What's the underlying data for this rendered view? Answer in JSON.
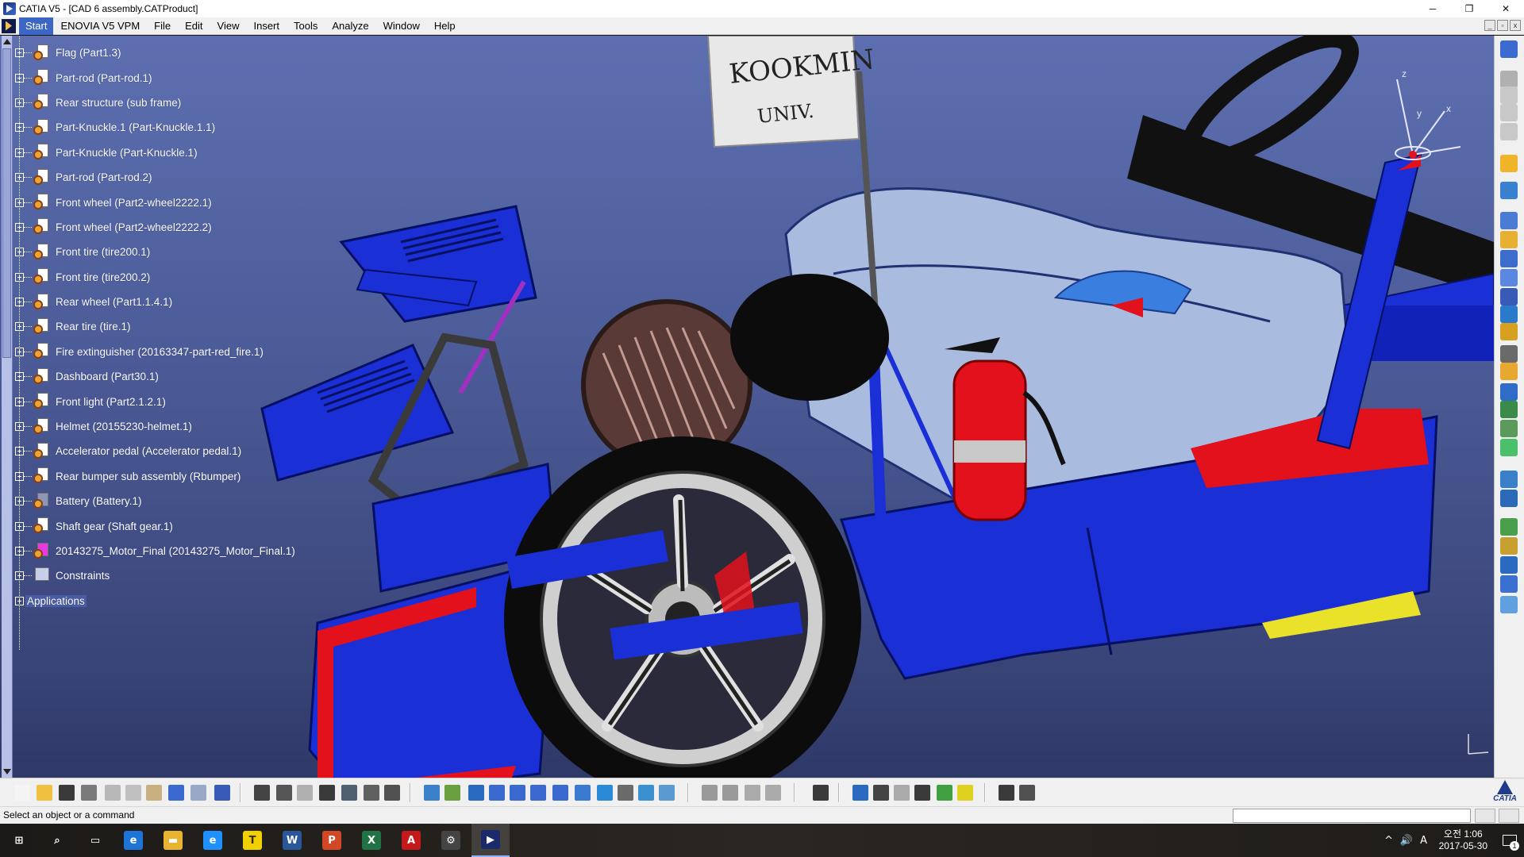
{
  "window": {
    "title": "CATIA V5 - [CAD 6 assembly.CATProduct]",
    "controls": [
      "─",
      "❐",
      "✕"
    ]
  },
  "menu": {
    "items": [
      "Start",
      "ENOVIA V5 VPM",
      "File",
      "Edit",
      "View",
      "Insert",
      "Tools",
      "Analyze",
      "Window",
      "Help"
    ],
    "mdi_controls": [
      "_",
      "▫",
      "x"
    ]
  },
  "tree": {
    "items": [
      {
        "label": "Flag (Part1.3)",
        "icon": "part-gear-icon"
      },
      {
        "label": "Part-rod (Part-rod.1)",
        "icon": "part-gear-icon"
      },
      {
        "label": "Rear structure (sub frame)",
        "icon": "part-gear-icon"
      },
      {
        "label": "Part-Knuckle.1 (Part-Knuckle.1.1)",
        "icon": "part-gear-icon"
      },
      {
        "label": "Part-Knuckle (Part-Knuckle.1)",
        "icon": "part-gear-icon"
      },
      {
        "label": "Part-rod (Part-rod.2)",
        "icon": "part-gear-icon"
      },
      {
        "label": "Front wheel  (Part2-wheel2222.1)",
        "icon": "part-gear-icon"
      },
      {
        "label": "Front wheel  (Part2-wheel2222.2)",
        "icon": "part-gear-icon"
      },
      {
        "label": "Front tire (tire200.1)",
        "icon": "part-gear-icon"
      },
      {
        "label": "Front tire (tire200.2)",
        "icon": "part-gear-icon"
      },
      {
        "label": "Rear wheel (Part1.1.4.1)",
        "icon": "part-gear-icon"
      },
      {
        "label": "Rear tire  (tire.1)",
        "icon": "part-gear-icon"
      },
      {
        "label": "Fire extinguisher (20163347-part-red_fire.1)",
        "icon": "part-gear-icon"
      },
      {
        "label": "Dashboard (Part30.1)",
        "icon": "part-gear-icon"
      },
      {
        "label": "Front light (Part2.1.2.1)",
        "icon": "part-gear-icon"
      },
      {
        "label": "Helmet (20155230-helmet.1)",
        "icon": "part-gear-icon"
      },
      {
        "label": "Accelerator pedal (Accelerator pedal.1)",
        "icon": "part-gear-icon"
      },
      {
        "label": "Rear bumper sub assembly (Rbumper)",
        "icon": "part-gear-icon"
      },
      {
        "label": "Battery (Battery.1)",
        "icon": "battery-part-icon"
      },
      {
        "label": "Shaft gear (Shaft gear.1)",
        "icon": "part-gear-icon"
      },
      {
        "label": "20143275_Motor_Final (20143275_Motor_Final.1)",
        "icon": "motor-part-icon"
      },
      {
        "label": "Constraints",
        "icon": "constraints-icon"
      }
    ],
    "applications_label": "Applications"
  },
  "scene": {
    "flag_text_line1": "KOOKMIN",
    "flag_text_line2": "UNIV.",
    "compass_labels": [
      "z",
      "y",
      "x"
    ]
  },
  "statusbar": {
    "prompt": "Select an object or a command",
    "command_value": ""
  },
  "taskbar": {
    "items": [
      "start-icon",
      "search-icon",
      "task-view-icon",
      "edge-icon",
      "file-explorer-icon",
      "internet-explorer-icon",
      "kakaotalk-icon",
      "word-icon",
      "powerpoint-icon",
      "excel-icon",
      "acrobat-icon",
      "catia-plm-icon",
      "catia-active-icon"
    ],
    "clock_period": "오전",
    "clock_time": "1:06",
    "date": "2017-05-30",
    "ime": "A",
    "notification_count": "1"
  },
  "colors": {
    "body_blue": "#1a2fd6",
    "accent_red": "#e2111c",
    "seat_light": "#a9bce0",
    "viewport_top": "#5d6fb0",
    "viewport_bottom": "#2f3968"
  }
}
